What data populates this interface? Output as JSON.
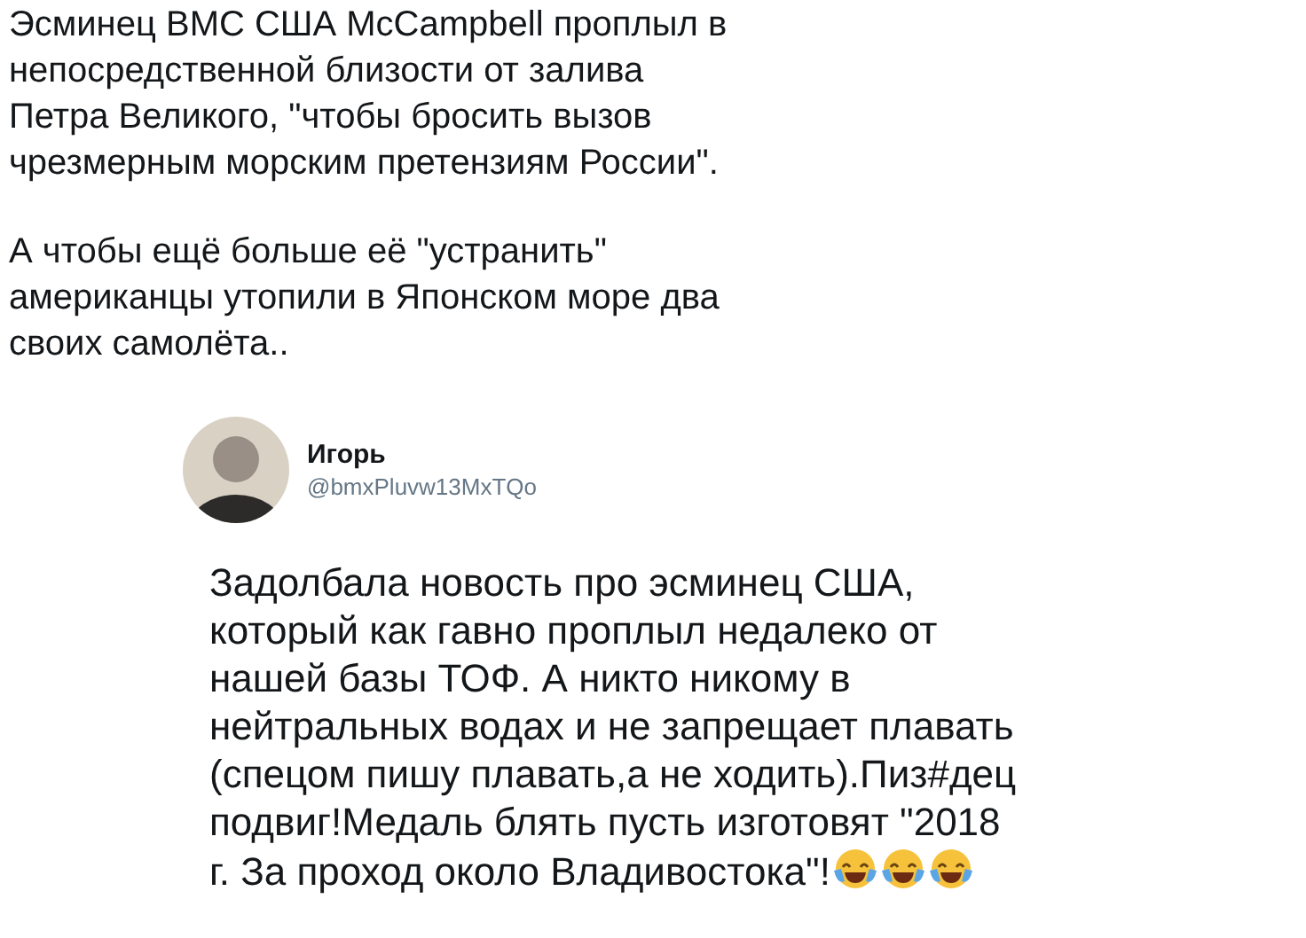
{
  "post": {
    "paragraphs": [
      [
        "Эсминец ВМС США McCampbell проплыл в",
        "непосредственной близости от залива",
        "Петра Великого, \"чтобы бросить вызов",
        "чрезмерным морским претензиям России\"."
      ],
      [
        "А чтобы ещё больше её \"устранить\"",
        "американцы утопили в Японском море два",
        "своих самолёта.."
      ]
    ]
  },
  "quoted_tweet": {
    "name": "Игорь",
    "handle": "@bmxPluvw13MxTQo",
    "lines": [
      "Задолбала новость про эсминец США,",
      "который как гавно проплыл недалеко от",
      "нашей базы ТОФ. А никто никому в",
      "нейтральных водах и не запрещает плавать",
      "(спецом пишу плавать,а не ходить).Пиз#дец",
      "подвиг!Медаль блять пусть изготовят \"2018",
      "г. За проход около Владивостока\"!"
    ],
    "emojis": [
      {
        "kind": "laugh"
      },
      {
        "kind": "laugh"
      },
      {
        "kind": "laugh"
      }
    ]
  }
}
